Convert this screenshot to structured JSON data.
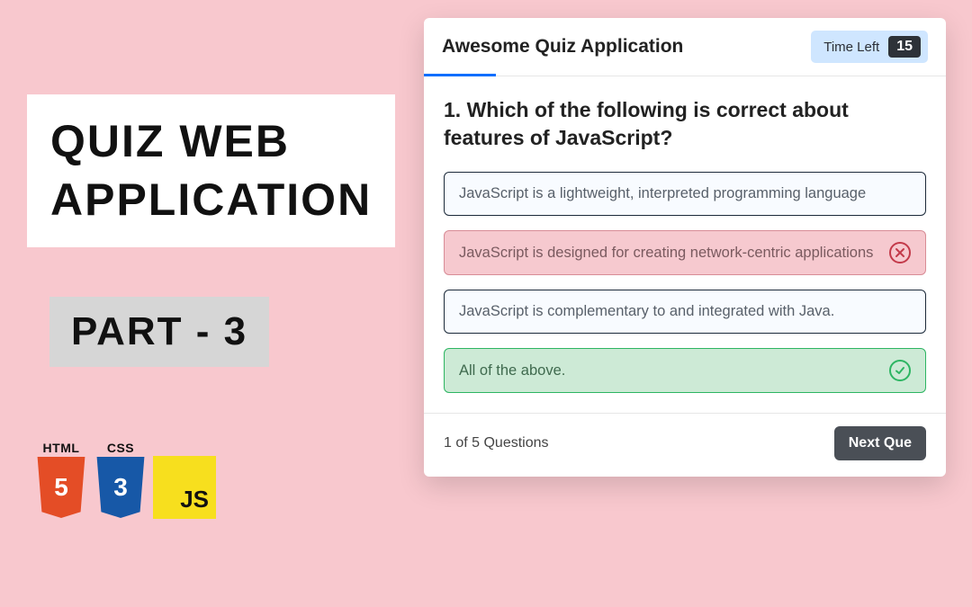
{
  "promo": {
    "title_line1": "QUIZ  WEB",
    "title_line2": "APPLICATION",
    "part": "PART - 3",
    "badges": {
      "html_label": "HTML",
      "html_glyph": "5",
      "css_label": "CSS",
      "css_glyph": "3",
      "js_glyph": "JS"
    }
  },
  "quiz": {
    "title": "Awesome Quiz Application",
    "timer_label": "Time Left",
    "timer_value": "15",
    "question": "1. Which of the following is correct about features of JavaScript?",
    "options": [
      {
        "text": "JavaScript is a lightweight, interpreted programming language",
        "state": "default"
      },
      {
        "text": "JavaScript is designed for creating network-centric applications",
        "state": "wrong"
      },
      {
        "text": "JavaScript is complementary to and integrated with Java.",
        "state": "default"
      },
      {
        "text": "All of the above.",
        "state": "correct"
      }
    ],
    "footer_count": "1 of 5 Questions",
    "next_label": "Next Que"
  }
}
